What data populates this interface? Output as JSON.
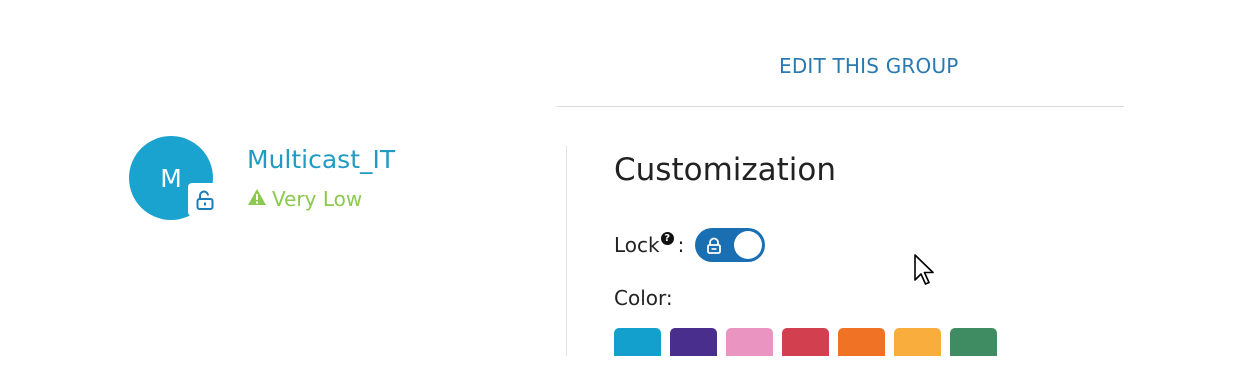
{
  "header": {
    "edit_link": "EDIT THIS GROUP"
  },
  "group": {
    "avatar_letter": "M",
    "name": "Multicast_IT",
    "risk_level": "Very Low",
    "risk_color": "#8cc94f",
    "avatar_color": "#1aa3cf"
  },
  "customization": {
    "title": "Customization",
    "lock_label": "Lock",
    "help_glyph": "?",
    "colon": ":",
    "lock_enabled": true,
    "toggle_color": "#1a6fb3",
    "color_label": "Color",
    "color_colon": ":",
    "swatches": [
      "#14a0cc",
      "#4a2e8e",
      "#e994c1",
      "#d2404f",
      "#f07225",
      "#f8ad3c",
      "#3f8c63"
    ]
  },
  "icons": [
    "unlock-icon",
    "warning-triangle-icon",
    "help-icon",
    "lock-icon",
    "mouse-cursor-icon"
  ]
}
